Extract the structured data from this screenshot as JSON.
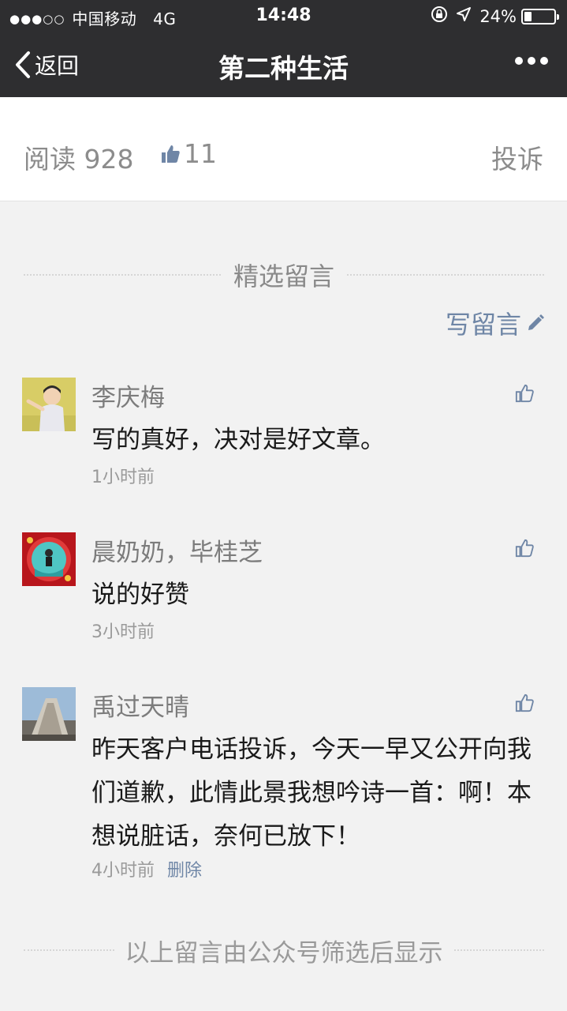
{
  "status_bar": {
    "signal": "●●●○○",
    "carrier": "中国移动",
    "network": "4G",
    "time": "14:48",
    "battery_text": "24%",
    "battery_level": 0.24
  },
  "nav": {
    "back_label": "返回",
    "title": "第二种生活"
  },
  "stats": {
    "read_label": "阅读 928",
    "like_count": "11",
    "report_label": "投诉"
  },
  "section": {
    "title": "精选留言",
    "write_label": "写留言"
  },
  "comments": [
    {
      "name": "李庆梅",
      "text": "写的真好，决对是好文章。",
      "time": "1小时前"
    },
    {
      "name": "晨奶奶，毕桂芝",
      "text": "说的好赞",
      "time": "3小时前"
    },
    {
      "name": "禹过天晴",
      "text": "昨天客户电话投诉，今天一早又公开向我们道歉，此情此景我想吟诗一首：啊！本想说脏话，奈何已放下！",
      "time": "4小时前",
      "delete_label": "删除"
    }
  ],
  "footer": "以上留言由公众号筛选后显示",
  "colors": {
    "nav_bg": "#2e2e30",
    "link": "#6f86a6",
    "page_bg": "#f2f2f2"
  }
}
